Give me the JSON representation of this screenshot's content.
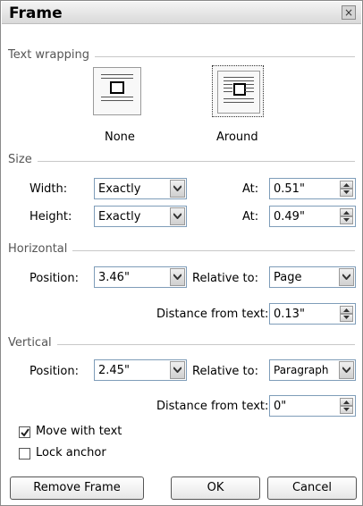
{
  "dialog": {
    "title": "Frame",
    "close_label": "×"
  },
  "text_wrapping": {
    "heading": "Text wrapping",
    "none_label": "None",
    "around_label": "Around",
    "selected": "Around"
  },
  "size": {
    "heading": "Size",
    "width_label": "Width:",
    "width_rule": "Exactly",
    "width_at_label": "At:",
    "width_at_value": "0.51\"",
    "height_label": "Height:",
    "height_rule": "Exactly",
    "height_at_label": "At:",
    "height_at_value": "0.49\""
  },
  "horizontal": {
    "heading": "Horizontal",
    "position_label": "Position:",
    "position_value": "3.46\"",
    "relative_label": "Relative to:",
    "relative_value": "Page",
    "distance_label": "Distance from text:",
    "distance_value": "0.13\""
  },
  "vertical": {
    "heading": "Vertical",
    "position_label": "Position:",
    "position_value": "2.45\"",
    "relative_label": "Relative to:",
    "relative_value": "Paragraph",
    "distance_label": "Distance from text:",
    "distance_value": "0\""
  },
  "options": {
    "move_with_text_label": "Move with text",
    "move_with_text_checked": true,
    "lock_anchor_label": "Lock anchor",
    "lock_anchor_checked": false
  },
  "buttons": {
    "remove": "Remove Frame",
    "ok": "OK",
    "cancel": "Cancel"
  },
  "icons": {
    "close": "close-icon",
    "dropdown": "chevron-down-icon",
    "spin": "spin-arrows-icon",
    "check": "checkmark-icon"
  }
}
